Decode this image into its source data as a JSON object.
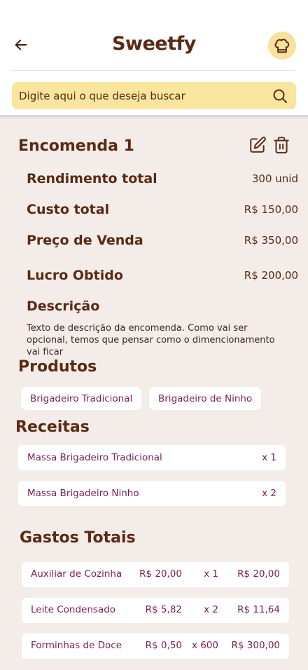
{
  "header": {
    "title": "Sweetfy",
    "back_icon": "arrow-left-icon",
    "profile_icon": "chef-hat-icon"
  },
  "search": {
    "placeholder": "Digite aqui o que deseja buscar"
  },
  "order": {
    "title": "Encomenda 1",
    "stats": [
      {
        "label": "Rendimento total",
        "value": "300 unid"
      },
      {
        "label": "Custo total",
        "value": "R$ 150,00"
      },
      {
        "label": "Preço de Venda",
        "value": "R$ 350,00"
      },
      {
        "label": "Lucro Obtido",
        "value": "R$ 200,00"
      }
    ],
    "description_label": "Descrição",
    "description": "Texto de descrição da encomenda. Como vai ser opcional, temos que pensar como o dimencionamento vai ficar"
  },
  "products": {
    "title": "Produtos",
    "items": [
      "Brigadeiro Tradicional",
      "Brigadeiro de Ninho"
    ]
  },
  "recipes": {
    "title": "Receitas",
    "items": [
      {
        "name": "Massa Brigadeiro Tradicional",
        "qty": "x 1"
      },
      {
        "name": "Massa Brigadeiro Ninho",
        "qty": "x 2"
      }
    ]
  },
  "costs": {
    "title": "Gastos Totais",
    "items": [
      {
        "name": "Auxiliar de Cozinha",
        "unit_price": "R$ 20,00",
        "qty": "x 1",
        "total": "R$ 20,00"
      },
      {
        "name": "Leite Condensado",
        "unit_price": "R$ 5,82",
        "qty": "x 2",
        "total": "R$ 11,64"
      },
      {
        "name": "Forminhas de Doce",
        "unit_price": "R$ 0,50",
        "qty": "x 600",
        "total": "R$ 300,00"
      }
    ]
  },
  "colors": {
    "primary": "#5a2a14",
    "accent": "#f9e59e",
    "background": "#f4ece9",
    "link": "#7a1f54"
  }
}
